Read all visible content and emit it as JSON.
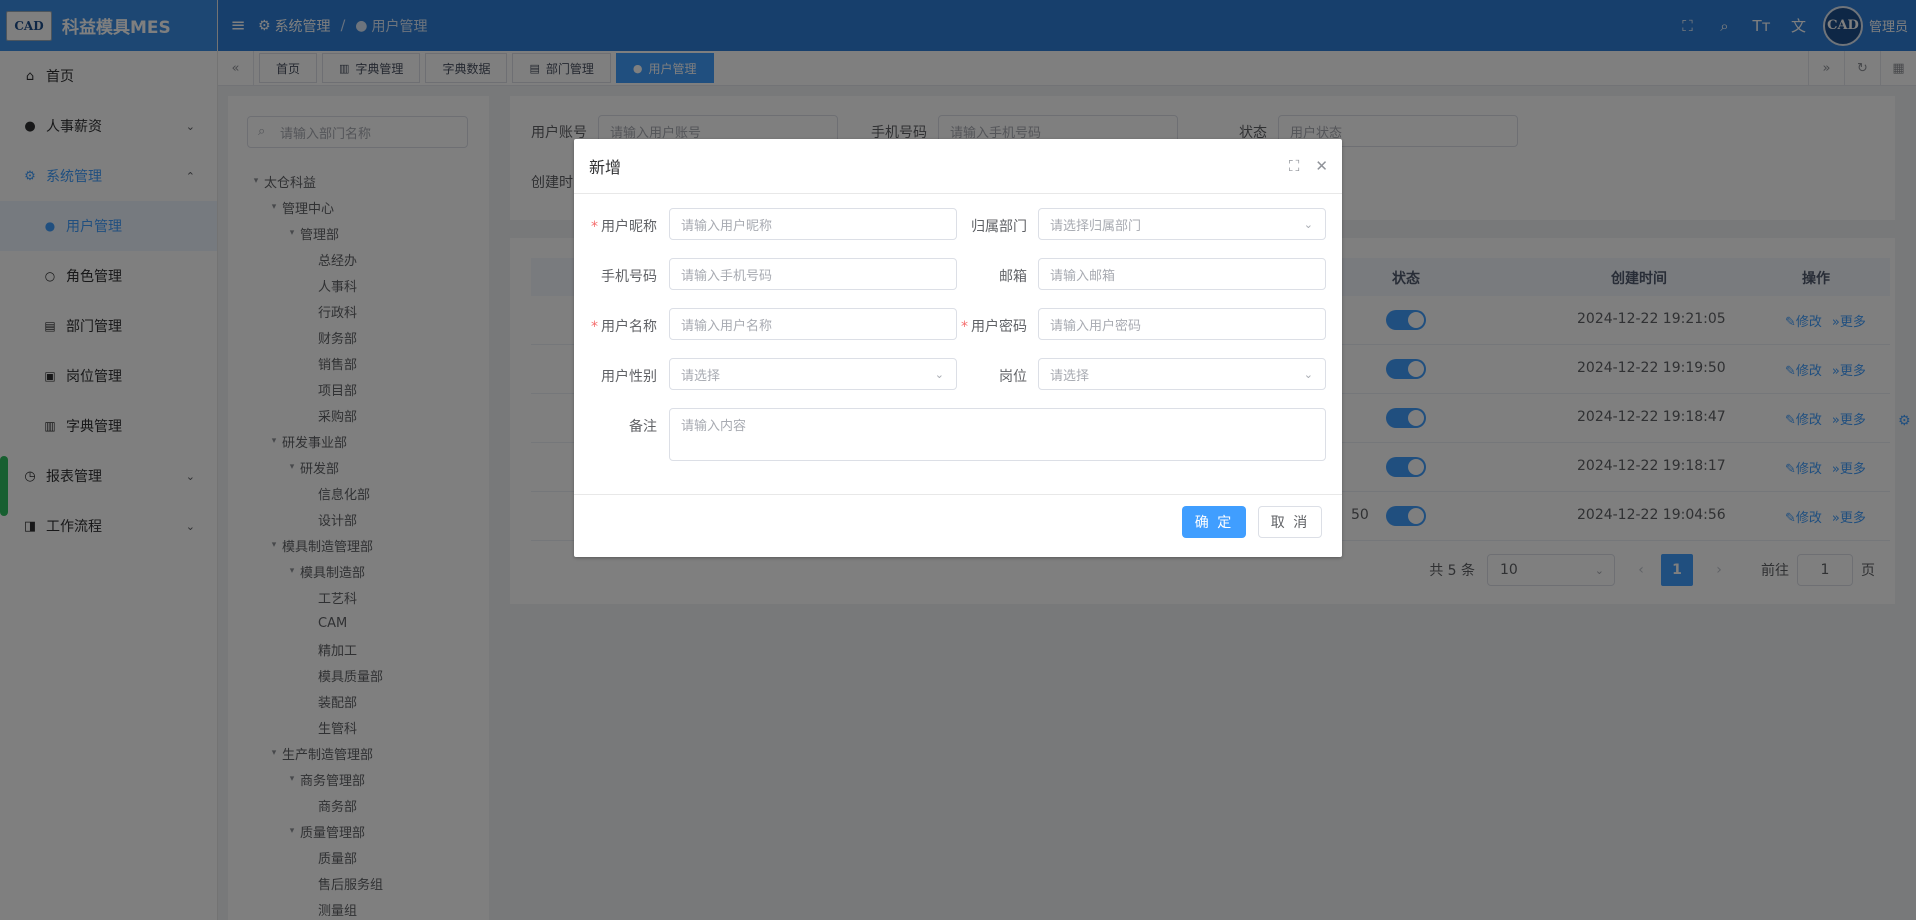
{
  "app": {
    "logo_text": "CAD",
    "title": "科益模具MES"
  },
  "sidebar": {
    "items": [
      {
        "label": "首页",
        "icon": "home-icon"
      },
      {
        "label": "人事薪资",
        "icon": "user-icon"
      },
      {
        "label": "系统管理",
        "icon": "gear-icon"
      },
      {
        "label": "报表管理",
        "icon": "clock-icon"
      },
      {
        "label": "工作流程",
        "icon": "flow-icon"
      }
    ],
    "sub_items": [
      {
        "label": "用户管理",
        "icon": "user-icon"
      },
      {
        "label": "角色管理",
        "icon": "person-outline-icon"
      },
      {
        "label": "部门管理",
        "icon": "id-card-icon"
      },
      {
        "label": "岗位管理",
        "icon": "badge-icon"
      },
      {
        "label": "字典管理",
        "icon": "book-icon"
      }
    ]
  },
  "header": {
    "breadcrumb": [
      "系统管理",
      "用户管理"
    ],
    "user": "管理员",
    "avatar_text": "CAD"
  },
  "tags": [
    {
      "label": "首页",
      "icon": ""
    },
    {
      "label": "字典管理",
      "icon": "book-icon"
    },
    {
      "label": "字典数据",
      "icon": ""
    },
    {
      "label": "部门管理",
      "icon": "id-card-icon"
    },
    {
      "label": "用户管理",
      "icon": "user-icon"
    }
  ],
  "dept": {
    "search_placeholder": "请输入部门名称",
    "tree": [
      "太仓科益",
      "管理中心",
      "管理部",
      "总经办",
      "人事科",
      "行政科",
      "财务部",
      "销售部",
      "项目部",
      "采购部",
      "研发事业部",
      "研发部",
      "信息化部",
      "设计部",
      "模具制造管理部",
      "模具制造部",
      "工艺科",
      "CAM",
      "精加工",
      "模具质量部",
      "装配部",
      "生管科",
      "生产制造管理部",
      "商务管理部",
      "商务部",
      "质量管理部",
      "质量部",
      "售后服务组",
      "测量组"
    ]
  },
  "search": {
    "account_label": "用户账号",
    "account_placeholder": "请输入用户账号",
    "phone_label": "手机号码",
    "phone_placeholder": "请输入手机号码",
    "status_label": "状态",
    "status_placeholder": "用户状态",
    "created_label": "创建时"
  },
  "table": {
    "headers": {
      "status": "状态",
      "created": "创建时间",
      "ops": "操作"
    },
    "rows": [
      {
        "created": "2024-12-22 19:21:05"
      },
      {
        "created": "2024-12-22 19:19:50"
      },
      {
        "created": "2024-12-22 19:18:47"
      },
      {
        "created": "2024-12-22 19:18:17"
      },
      {
        "created": "2024-12-22 19:04:56",
        "partial": "50"
      }
    ],
    "edit_label": "修改",
    "more_label": "更多"
  },
  "pagination": {
    "total": "共 5 条",
    "size": "10",
    "page": "1",
    "goto_label": "前往",
    "goto_value": "1",
    "page_suffix": "页"
  },
  "dialog": {
    "title": "新增",
    "fields": {
      "nickname_label": "用户昵称",
      "nickname_placeholder": "请输入用户昵称",
      "dept_label": "归属部门",
      "dept_placeholder": "请选择归属部门",
      "phone_label": "手机号码",
      "phone_placeholder": "请输入手机号码",
      "email_label": "邮箱",
      "email_placeholder": "请输入邮箱",
      "username_label": "用户名称",
      "username_placeholder": "请输入用户名称",
      "password_label": "用户密码",
      "password_placeholder": "请输入用户密码",
      "gender_label": "用户性别",
      "gender_placeholder": "请选择",
      "post_label": "岗位",
      "post_placeholder": "请选择",
      "remark_label": "备注",
      "remark_placeholder": "请输入内容"
    },
    "ok": "确 定",
    "cancel": "取 消"
  },
  "colors": {
    "primary": "#409eff",
    "header": "#2f7fd8",
    "danger": "#f56c6c"
  }
}
